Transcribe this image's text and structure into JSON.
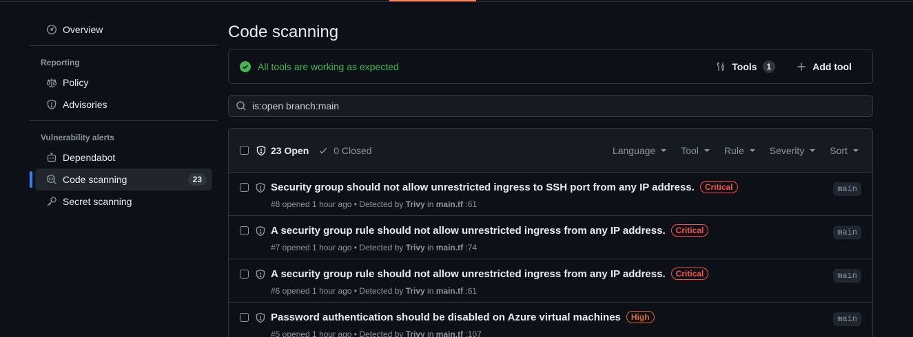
{
  "sidebar": {
    "overview": "Overview",
    "reporting_heading": "Reporting",
    "policy": "Policy",
    "advisories": "Advisories",
    "vuln_heading": "Vulnerability alerts",
    "dependabot": "Dependabot",
    "code_scanning": "Code scanning",
    "code_scanning_count": "23",
    "secret_scanning": "Secret scanning"
  },
  "main": {
    "title": "Code scanning",
    "status_text": "All tools are working as expected",
    "tools_label": "Tools",
    "tools_count": "1",
    "add_tool_label": "Add tool",
    "search_value": "is:open branch:main"
  },
  "list": {
    "open_label": "23 Open",
    "closed_label": "0 Closed",
    "filters": [
      "Language",
      "Tool",
      "Rule",
      "Severity",
      "Sort"
    ],
    "alerts": [
      {
        "title": "Security group should not allow unrestricted ingress to SSH port from any IP address.",
        "severity": "Critical",
        "meta_prefix": "#8 opened 1 hour ago • Detected by ",
        "tool": "Trivy",
        "meta_in": " in ",
        "file": "main.tf",
        "line": " :61",
        "branch": "main"
      },
      {
        "title": "A security group rule should not allow unrestricted ingress from any IP address.",
        "severity": "Critical",
        "meta_prefix": "#7 opened 1 hour ago • Detected by ",
        "tool": "Trivy",
        "meta_in": " in ",
        "file": "main.tf",
        "line": " :74",
        "branch": "main"
      },
      {
        "title": "A security group rule should not allow unrestricted ingress from any IP address.",
        "severity": "Critical",
        "meta_prefix": "#6 opened 1 hour ago • Detected by ",
        "tool": "Trivy",
        "meta_in": " in ",
        "file": "main.tf",
        "line": " :61",
        "branch": "main"
      },
      {
        "title": "Password authentication should be disabled on Azure virtual machines",
        "severity": "High",
        "meta_prefix": "#5 opened 1 hour ago • Detected by ",
        "tool": "Trivy",
        "meta_in": " in ",
        "file": "main.tf",
        "line": " :107",
        "branch": "main"
      }
    ]
  },
  "colors": {
    "background": "#0d1117",
    "accent_blue": "#2f81f7",
    "success_green": "#3fb950",
    "critical_red": "#f85149",
    "high_orange": "#db6d28",
    "top_accent": "#f78166"
  }
}
